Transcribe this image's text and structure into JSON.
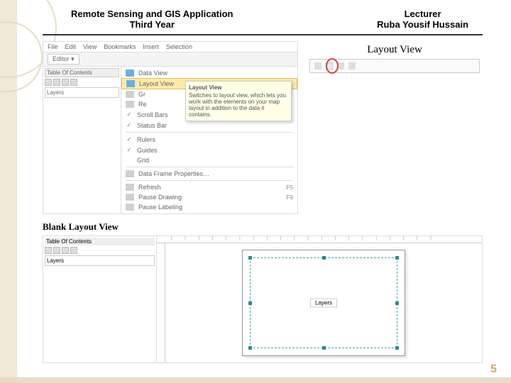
{
  "header": {
    "left_line1": "Remote Sensing and GIS Application",
    "left_line2": "Third Year",
    "right_line1": "Lecturer",
    "right_line2": "Ruba Yousif Hussain"
  },
  "arcmap": {
    "menubar": [
      "File",
      "Edit",
      "View",
      "Bookmarks",
      "Insert",
      "Selection"
    ],
    "editor_label": "Editor ▾",
    "toc_title": "Table Of Contents",
    "layers_label": "Layers",
    "view_menu": {
      "data_view": "Data View",
      "layout_view": "Layout View",
      "graphs": "Gr",
      "reports": "Re",
      "scrollbars": "Scroll Bars",
      "statusbar": "Status Bar",
      "rulers": "Rulers",
      "guides": "Guides",
      "grid": "Grid",
      "dfprops": "Data Frame Properties…",
      "refresh": "Refresh",
      "refresh_key": "F5",
      "pause_drawing": "Pause Drawing",
      "pause_drawing_key": "F9",
      "pause_labeling": "Pause Labeling"
    },
    "tooltip": {
      "title": "Layout View",
      "body": "Switches to layout view, which lets you work with the elements on your map layout in addition to the data it contains."
    }
  },
  "callout": {
    "label": "Layout View"
  },
  "section2": {
    "title": "Blank Layout View",
    "toc_title": "Table Of Contents",
    "layers_label": "Layers",
    "ruler_marks": "| | | | | | | | | | | | | | | | | | | |",
    "frame_label": "Layers"
  },
  "page_number": "5"
}
